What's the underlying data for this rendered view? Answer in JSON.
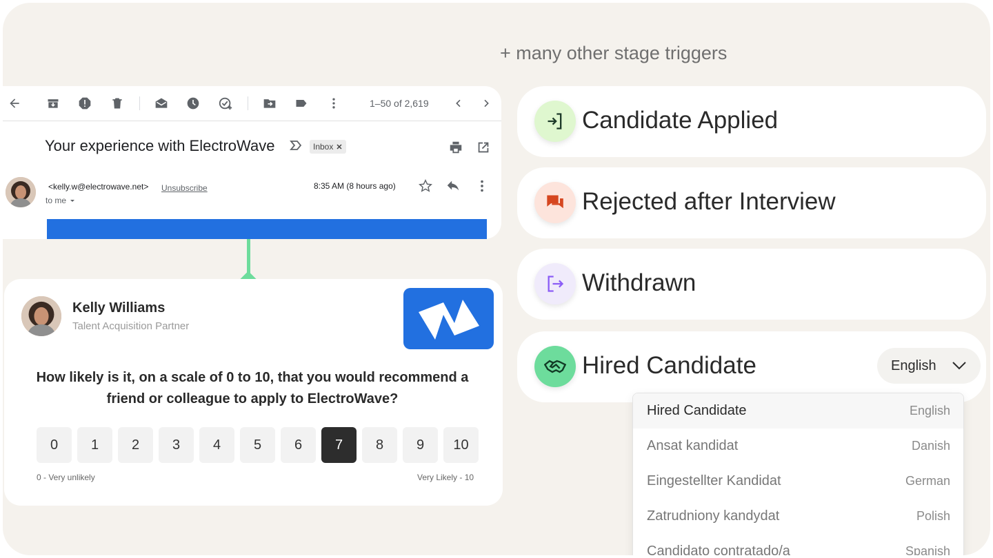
{
  "header": {
    "more_triggers": "+ many other stage triggers"
  },
  "gmail": {
    "pagination": "1–50 of 2,619",
    "subject": "Your experience with ElectroWave",
    "label": "Inbox",
    "label_close": "✕",
    "from": "<kelly.w@electrowave.net>",
    "unsubscribe": "Unsubscribe",
    "to": "to me",
    "time": "8:35 AM  (8 hours ago)"
  },
  "survey": {
    "name": "Kelly Williams",
    "role": "Talent Acquisition Partner",
    "question": "How likely is it, on a scale of 0 to 10, that you would recommend a friend or colleague to apply to ElectroWave?",
    "scale": [
      "0",
      "1",
      "2",
      "3",
      "4",
      "5",
      "6",
      "7",
      "8",
      "9",
      "10"
    ],
    "selected": "7",
    "low_label": "0 - Very unlikely",
    "high_label": "Very Likely - 10"
  },
  "triggers": [
    {
      "label": "Candidate Applied",
      "icon": "enter-icon",
      "color": "#dff7cf"
    },
    {
      "label": "Rejected after Interview",
      "icon": "chat-icon",
      "color": "#fde4dc"
    },
    {
      "label": "Withdrawn",
      "icon": "exit-icon",
      "color": "#f0ebfb"
    },
    {
      "label": "Hired Candidate",
      "icon": "handshake-icon",
      "color": "#6ddc9c"
    }
  ],
  "language_select": {
    "value": "English"
  },
  "language_options": [
    {
      "name": "Hired Candidate",
      "lang": "English"
    },
    {
      "name": "Ansat kandidat",
      "lang": "Danish"
    },
    {
      "name": "Eingestellter Kandidat",
      "lang": "German"
    },
    {
      "name": "Zatrudniony kandydat",
      "lang": "Polish"
    },
    {
      "name": "Candidato contratado/a",
      "lang": "Spanish"
    }
  ],
  "colors": {
    "background": "#f5f2ed",
    "brand_blue": "#2270e0",
    "accent_green": "#6ddc9c"
  }
}
